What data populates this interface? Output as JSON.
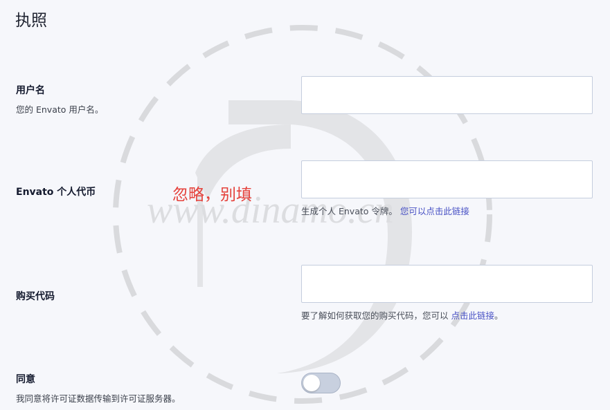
{
  "page": {
    "title": "执照"
  },
  "watermark": {
    "text": "www.dinamo.cn"
  },
  "annotation": {
    "text": "忽略，别填"
  },
  "username": {
    "label": "用户名",
    "description": "您的 Envato 用户名。",
    "value": ""
  },
  "token": {
    "label": "Envato 个人代币",
    "value": "",
    "help_prefix": "生成个人 Envato 令牌。",
    "help_link": "您可以点击此链接"
  },
  "purchase_code": {
    "label": "购买代码",
    "value": "",
    "help_prefix": "要了解如何获取您的购买代码，您可以",
    "help_link": "点击此链接",
    "help_suffix": "。"
  },
  "consent": {
    "label": "同意",
    "description": "我同意将许可证数据传输到许可证服务器。",
    "enabled": false
  },
  "colors": {
    "link": "#4750c4",
    "annotation": "#e5413b",
    "background": "#f6f7fb"
  }
}
